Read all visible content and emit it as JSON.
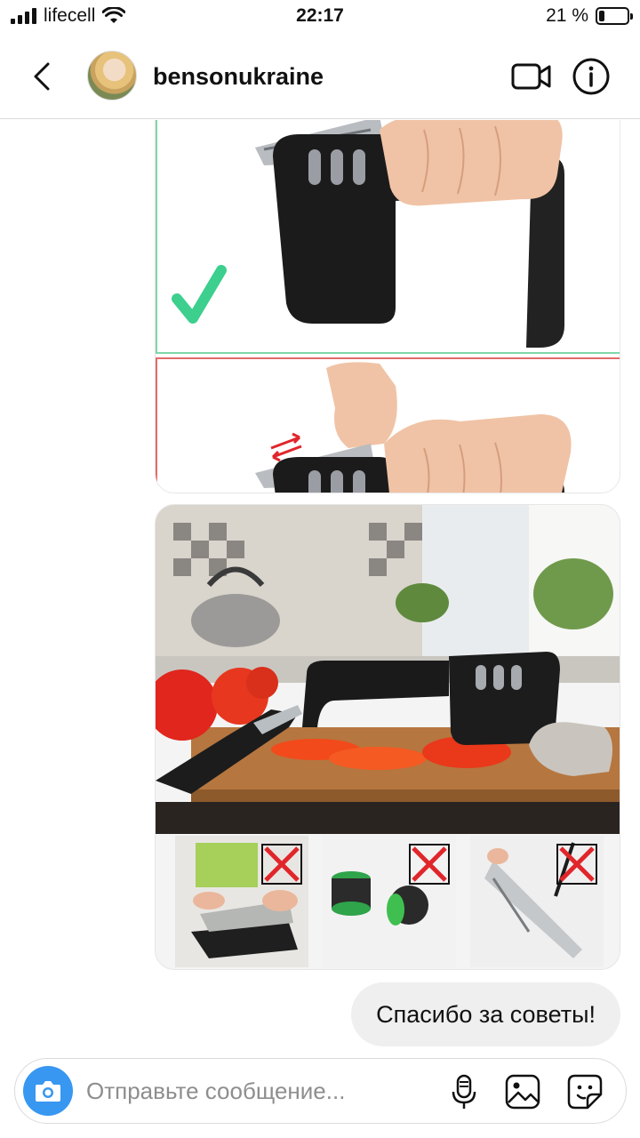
{
  "status_bar": {
    "carrier": "lifecell",
    "time": "22:17",
    "battery_text": "21 %",
    "battery_level": 0.21
  },
  "header": {
    "username": "bensonukraine",
    "back_icon": "chevron-left-icon",
    "video_icon": "video-call-icon",
    "info_icon": "info-icon"
  },
  "messages": [
    {
      "type": "image",
      "from": "other",
      "description_icon": "sharpener-usage-image"
    },
    {
      "type": "image",
      "from": "other",
      "description_icon": "sharpener-kitchen-image"
    },
    {
      "type": "text",
      "from": "me",
      "text": "Спасибо за советы!"
    }
  ],
  "composer": {
    "placeholder": "Отправьте сообщение...",
    "value": ""
  },
  "colors": {
    "accent": "#3897f0",
    "ok_green": "#3ccf8e",
    "bad_red": "#e0262b",
    "bubble_grey": "#efefef"
  }
}
